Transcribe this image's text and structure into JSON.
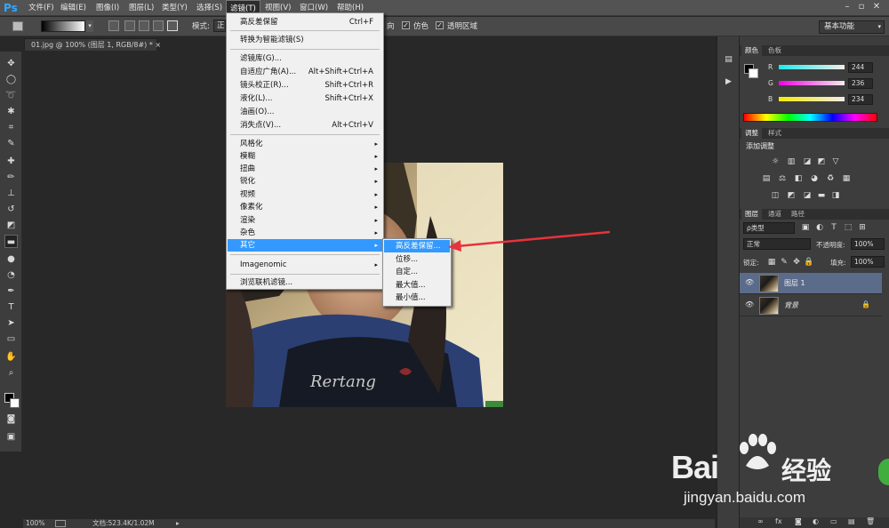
{
  "app": {
    "logo": "Ps"
  },
  "menubar": {
    "items": [
      "文件(F)",
      "编辑(E)",
      "图像(I)",
      "图层(L)",
      "类型(Y)",
      "选择(S)",
      "滤镜(T)",
      "视图(V)",
      "窗口(W)",
      "帮助(H)"
    ],
    "active_index": 6
  },
  "options": {
    "mode_label": "模式:",
    "mode_value": "正",
    "direction_partial": "向",
    "dither_label": "仿色",
    "transparency_label": "透明区域",
    "workspace": "基本功能"
  },
  "document": {
    "tab_label": "01.jpg @ 100% (图层 1, RGB/8#) *",
    "close_glyph": "×",
    "zoom": "100%",
    "doc_info": "文档:523.4K/1.02M"
  },
  "filter_menu": {
    "last_filter": {
      "label": "高反差保留",
      "shortcut": "Ctrl+F"
    },
    "smart_filter": "转换为智能滤镜(S)",
    "group1": [
      {
        "label": "滤镜库(G)...",
        "shortcut": ""
      },
      {
        "label": "自适应广角(A)...",
        "shortcut": "Alt+Shift+Ctrl+A"
      },
      {
        "label": "镜头校正(R)...",
        "shortcut": "Shift+Ctrl+R"
      },
      {
        "label": "液化(L)...",
        "shortcut": "Shift+Ctrl+X"
      },
      {
        "label": "油画(O)...",
        "shortcut": ""
      },
      {
        "label": "消失点(V)...",
        "shortcut": "Alt+Ctrl+V"
      }
    ],
    "group2": [
      "风格化",
      "模糊",
      "扭曲",
      "锐化",
      "视频",
      "像素化",
      "渲染",
      "杂色",
      "其它"
    ],
    "highlighted": "其它",
    "plugin": "Imagenomic",
    "browse": "浏览联机滤镜...",
    "arrow_glyph": "▸"
  },
  "sub_menu": {
    "items": [
      "高反差保留...",
      "位移...",
      "自定...",
      "最大值...",
      "最小值..."
    ],
    "highlighted_index": 0
  },
  "color_panel": {
    "tabs": [
      "颜色",
      "色板"
    ],
    "channels": [
      {
        "label": "R",
        "value": "244",
        "color": "#f43060"
      },
      {
        "label": "G",
        "value": "236",
        "color": "#40ec40"
      },
      {
        "label": "B",
        "value": "234",
        "color": "#4040ea"
      }
    ]
  },
  "adjust_panel": {
    "tabs": [
      "调整",
      "样式"
    ],
    "title": "添加调整"
  },
  "layers_panel": {
    "tabs": [
      "图层",
      "通道",
      "路径"
    ],
    "kind_filter": "ρ类型",
    "blend_mode": "正常",
    "opacity_label": "不透明度:",
    "opacity_value": "100%",
    "lock_label": "锁定:",
    "fill_label": "填充:",
    "fill_value": "100%",
    "layers": [
      {
        "name": "图层 1",
        "selected": true,
        "locked": false
      },
      {
        "name": "背景",
        "selected": false,
        "locked": true
      }
    ]
  },
  "watermark": {
    "brand": "Bai",
    "brand_suffix": "经验",
    "url": "jingyan.baidu.com"
  },
  "colors": {
    "menubar": "#535353",
    "highlight": "#3399ff",
    "arrow": "#e8323c",
    "selected_layer": "#5b6b8a"
  }
}
